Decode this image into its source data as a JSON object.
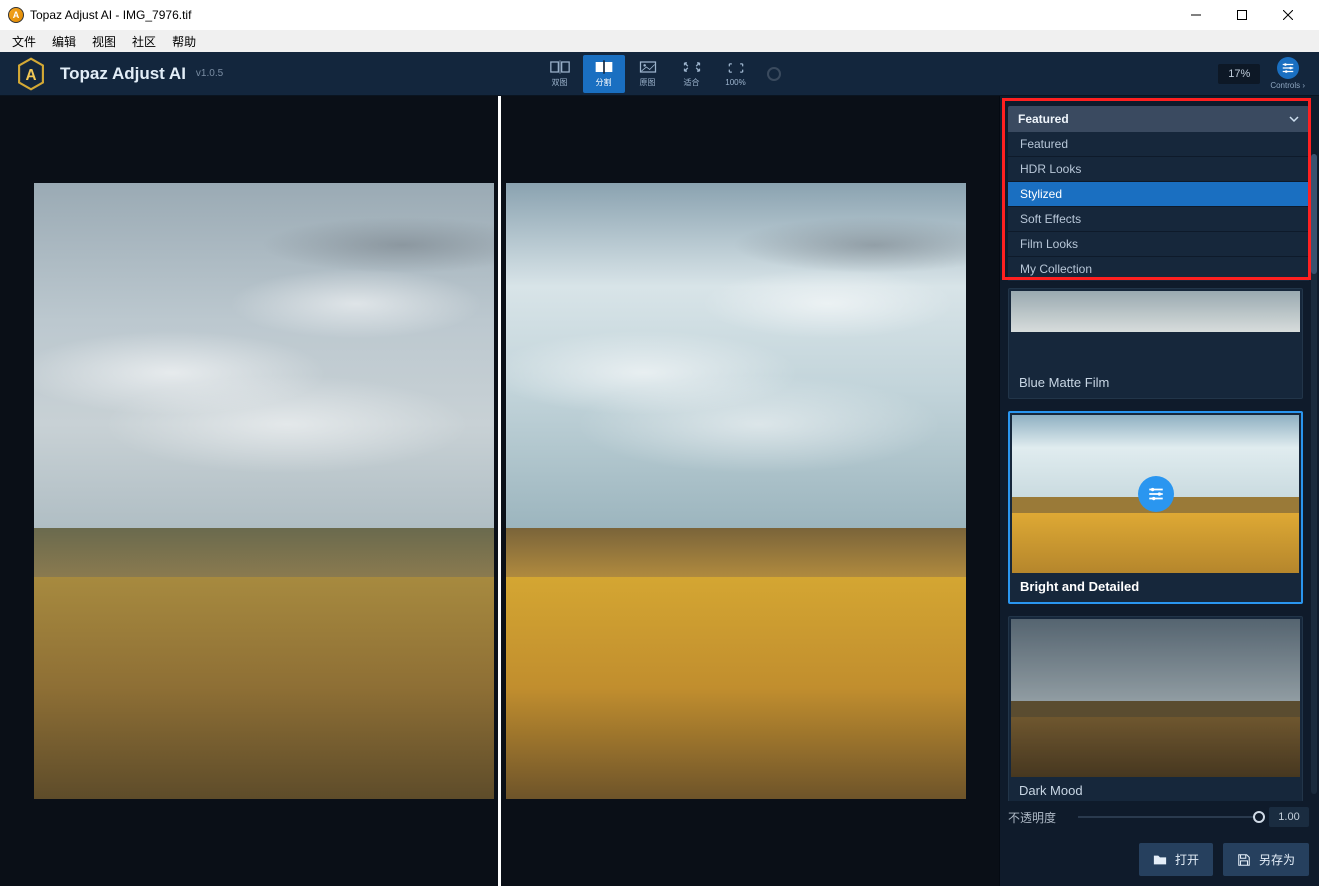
{
  "window": {
    "title": "Topaz Adjust AI - IMG_7976.tif"
  },
  "menu": {
    "file": "文件",
    "edit": "编辑",
    "view": "视图",
    "community": "社区",
    "help": "帮助"
  },
  "header": {
    "app_name": "Topaz Adjust AI",
    "version": "v1.0.5",
    "controls_label": "Controls"
  },
  "tools": {
    "dual": "双图",
    "split": "分割",
    "original": "原图",
    "fit": "适合",
    "hundred": "100%",
    "zoom": "17%"
  },
  "dropdown": {
    "selected": "Featured",
    "items": [
      "Featured",
      "HDR Looks",
      "Stylized",
      "Soft Effects",
      "Film Looks",
      "My Collection"
    ]
  },
  "presets": [
    {
      "name": "Blue Matte Film"
    },
    {
      "name": "Bright and Detailed"
    },
    {
      "name": "Dark Mood"
    }
  ],
  "opacity": {
    "label": "不透明度",
    "value": "1.00"
  },
  "buttons": {
    "open": "打开",
    "saveas": "另存为"
  }
}
